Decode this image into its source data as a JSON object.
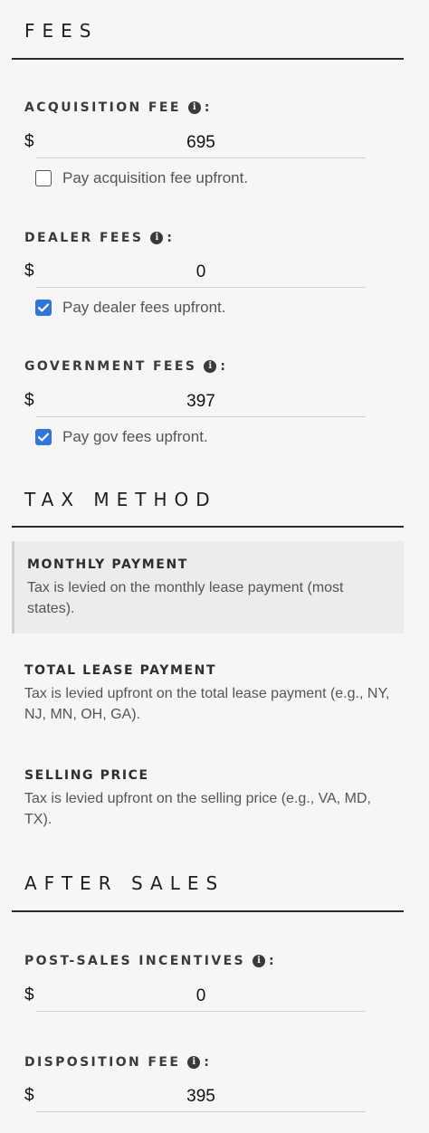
{
  "fees": {
    "title": "FEES",
    "acquisition": {
      "label": "ACQUISITION FEE",
      "currency": "$",
      "value": "695",
      "checkbox_label": "Pay acquisition fee upfront.",
      "checked": false
    },
    "dealer": {
      "label": "DEALER FEES",
      "currency": "$",
      "value": "0",
      "checkbox_label": "Pay dealer fees upfront.",
      "checked": true
    },
    "government": {
      "label": "GOVERNMENT FEES",
      "currency": "$",
      "value": "397",
      "checkbox_label": "Pay gov fees upfront.",
      "checked": true
    }
  },
  "tax_method": {
    "title": "TAX METHOD",
    "options": [
      {
        "title": "MONTHLY PAYMENT",
        "description": "Tax is levied on the monthly lease payment (most states).",
        "selected": true
      },
      {
        "title": "TOTAL LEASE PAYMENT",
        "description": "Tax is levied upfront on the total lease payment (e.g., NY, NJ, MN, OH, GA).",
        "selected": false
      },
      {
        "title": "SELLING PRICE",
        "description": "Tax is levied upfront on the selling price (e.g., VA, MD, TX).",
        "selected": false
      }
    ]
  },
  "after_sales": {
    "title": "AFTER SALES",
    "post_sales_incentives": {
      "label": "POST-SALES INCENTIVES",
      "currency": "$",
      "value": "0"
    },
    "disposition_fee": {
      "label": "DISPOSITION FEE",
      "currency": "$",
      "value": "395"
    }
  },
  "icons": {
    "info": "info-icon",
    "check": "checkmark-icon"
  },
  "colors": {
    "checkbox_checked": "#2f74e0",
    "selected_option_bg": "#ececec"
  }
}
